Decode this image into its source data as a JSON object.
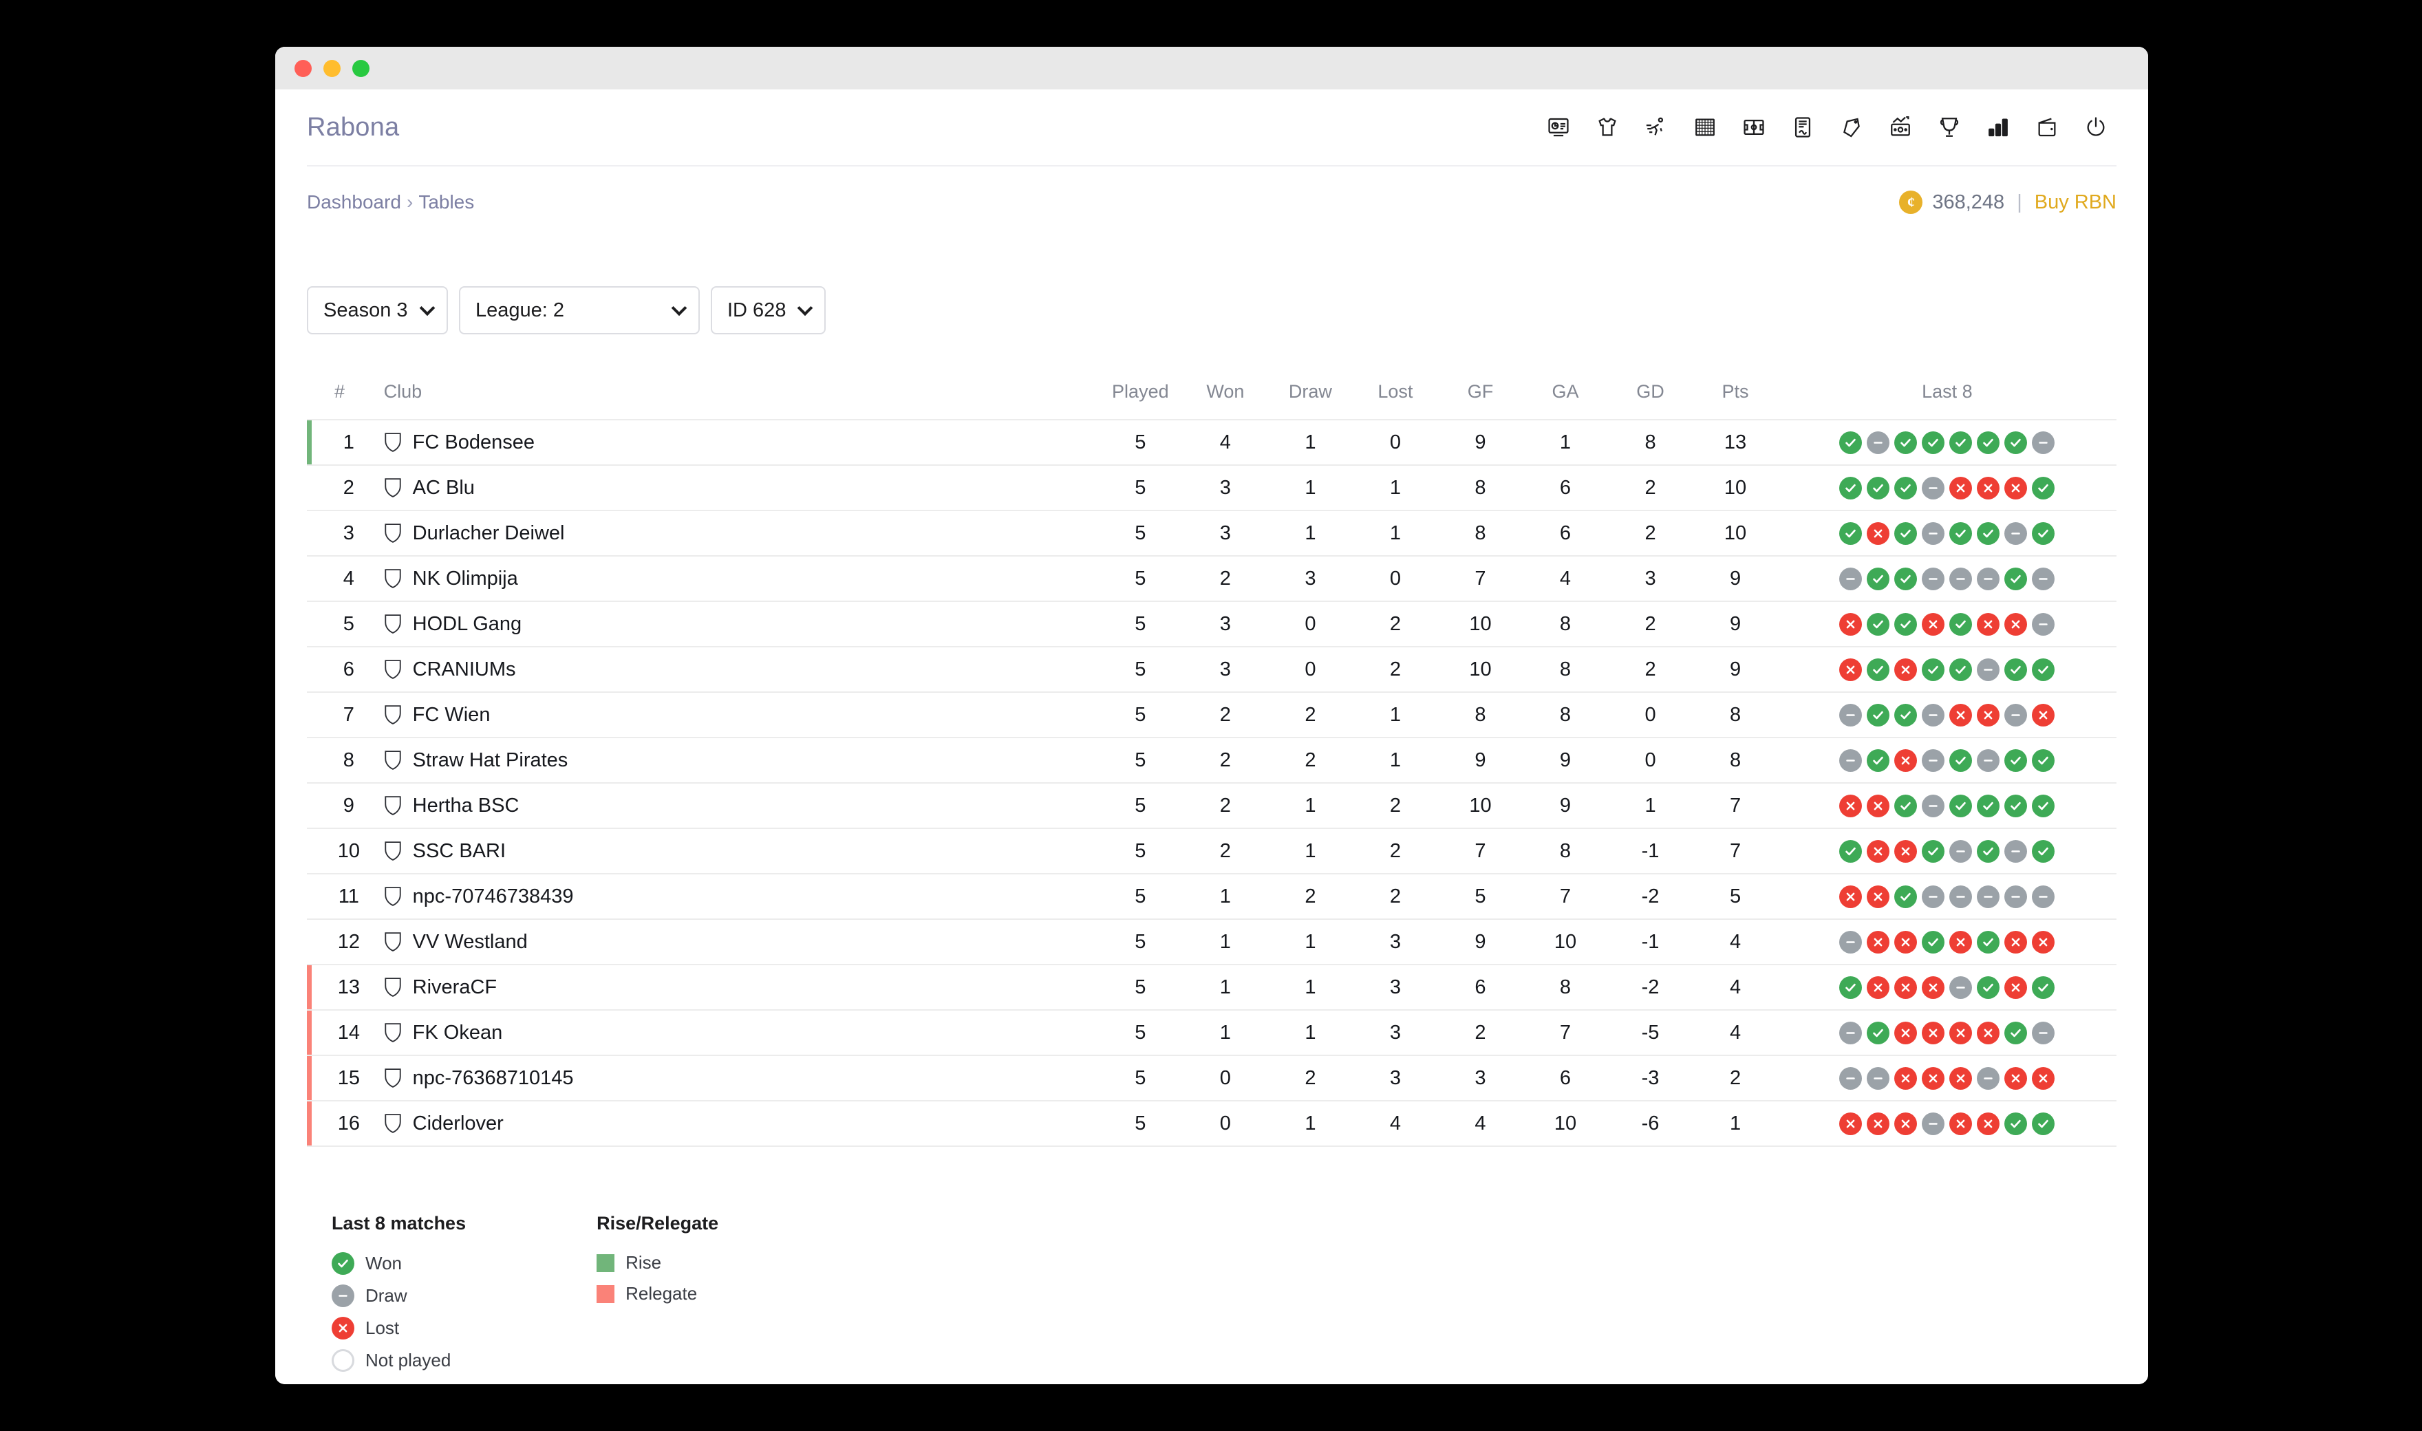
{
  "window": {
    "traffic_lights": [
      "close",
      "minimize",
      "maximize"
    ]
  },
  "header": {
    "brand": "Rabona",
    "icons": [
      "dashboard-icon",
      "jersey-icon",
      "training-icon",
      "goal-net-icon",
      "pitch-icon",
      "contract-icon",
      "tag-icon",
      "transfer-market-icon",
      "trophy-icon",
      "statistics-icon",
      "wallet-icon",
      "power-icon"
    ]
  },
  "breadcrumb": {
    "root": "Dashboard",
    "separator": "›",
    "current": "Tables"
  },
  "balance": {
    "coin_symbol": "¢",
    "amount": "368,248",
    "pipe": "|",
    "buy_label": "Buy RBN",
    "accent_color": "#e0a91e"
  },
  "filters": {
    "season": "Season 3",
    "league": "League: 2",
    "id": "ID 628"
  },
  "table": {
    "headers": {
      "rank": "#",
      "club": "Club",
      "played": "Played",
      "won": "Won",
      "draw": "Draw",
      "lost": "Lost",
      "gf": "GF",
      "ga": "GA",
      "gd": "GD",
      "pts": "Pts",
      "last8": "Last 8"
    },
    "rows": [
      {
        "rank": "1",
        "club": "FC Bodensee",
        "played": "5",
        "won": "4",
        "draw": "1",
        "lost": "0",
        "gf": "9",
        "ga": "1",
        "gd": "8",
        "pts": "13",
        "last8": [
          "W",
          "D",
          "W",
          "W",
          "W",
          "W",
          "W",
          "D"
        ],
        "zone": "rise"
      },
      {
        "rank": "2",
        "club": "AC Blu",
        "played": "5",
        "won": "3",
        "draw": "1",
        "lost": "1",
        "gf": "8",
        "ga": "6",
        "gd": "2",
        "pts": "10",
        "last8": [
          "W",
          "W",
          "W",
          "D",
          "L",
          "L",
          "L",
          "W"
        ],
        "zone": ""
      },
      {
        "rank": "3",
        "club": "Durlacher Deiwel",
        "played": "5",
        "won": "3",
        "draw": "1",
        "lost": "1",
        "gf": "8",
        "ga": "6",
        "gd": "2",
        "pts": "10",
        "last8": [
          "W",
          "L",
          "W",
          "D",
          "W",
          "W",
          "D",
          "W"
        ],
        "zone": ""
      },
      {
        "rank": "4",
        "club": "NK Olimpija",
        "played": "5",
        "won": "2",
        "draw": "3",
        "lost": "0",
        "gf": "7",
        "ga": "4",
        "gd": "3",
        "pts": "9",
        "last8": [
          "D",
          "W",
          "W",
          "D",
          "D",
          "D",
          "W",
          "D"
        ],
        "zone": ""
      },
      {
        "rank": "5",
        "club": "HODL Gang",
        "played": "5",
        "won": "3",
        "draw": "0",
        "lost": "2",
        "gf": "10",
        "ga": "8",
        "gd": "2",
        "pts": "9",
        "last8": [
          "L",
          "W",
          "W",
          "L",
          "W",
          "L",
          "L",
          "D"
        ],
        "zone": ""
      },
      {
        "rank": "6",
        "club": "CRANIUMs",
        "played": "5",
        "won": "3",
        "draw": "0",
        "lost": "2",
        "gf": "10",
        "ga": "8",
        "gd": "2",
        "pts": "9",
        "last8": [
          "L",
          "W",
          "L",
          "W",
          "W",
          "D",
          "W",
          "W"
        ],
        "zone": ""
      },
      {
        "rank": "7",
        "club": "FC Wien",
        "played": "5",
        "won": "2",
        "draw": "2",
        "lost": "1",
        "gf": "8",
        "ga": "8",
        "gd": "0",
        "pts": "8",
        "last8": [
          "D",
          "W",
          "W",
          "D",
          "L",
          "L",
          "D",
          "L"
        ],
        "zone": ""
      },
      {
        "rank": "8",
        "club": "Straw Hat Pirates",
        "played": "5",
        "won": "2",
        "draw": "2",
        "lost": "1",
        "gf": "9",
        "ga": "9",
        "gd": "0",
        "pts": "8",
        "last8": [
          "D",
          "W",
          "L",
          "D",
          "W",
          "D",
          "W",
          "W"
        ],
        "zone": ""
      },
      {
        "rank": "9",
        "club": "Hertha BSC",
        "played": "5",
        "won": "2",
        "draw": "1",
        "lost": "2",
        "gf": "10",
        "ga": "9",
        "gd": "1",
        "pts": "7",
        "last8": [
          "L",
          "L",
          "W",
          "D",
          "W",
          "W",
          "W",
          "W"
        ],
        "zone": ""
      },
      {
        "rank": "10",
        "club": "SSC BARI",
        "played": "5",
        "won": "2",
        "draw": "1",
        "lost": "2",
        "gf": "7",
        "ga": "8",
        "gd": "-1",
        "pts": "7",
        "last8": [
          "W",
          "L",
          "L",
          "W",
          "D",
          "W",
          "D",
          "W"
        ],
        "zone": ""
      },
      {
        "rank": "11",
        "club": "npc-70746738439",
        "played": "5",
        "won": "1",
        "draw": "2",
        "lost": "2",
        "gf": "5",
        "ga": "7",
        "gd": "-2",
        "pts": "5",
        "last8": [
          "L",
          "L",
          "W",
          "D",
          "D",
          "D",
          "D",
          "D"
        ],
        "zone": ""
      },
      {
        "rank": "12",
        "club": "VV Westland",
        "played": "5",
        "won": "1",
        "draw": "1",
        "lost": "3",
        "gf": "9",
        "ga": "10",
        "gd": "-1",
        "pts": "4",
        "last8": [
          "D",
          "L",
          "L",
          "W",
          "L",
          "W",
          "L",
          "L"
        ],
        "zone": ""
      },
      {
        "rank": "13",
        "club": "RiveraCF",
        "played": "5",
        "won": "1",
        "draw": "1",
        "lost": "3",
        "gf": "6",
        "ga": "8",
        "gd": "-2",
        "pts": "4",
        "last8": [
          "W",
          "L",
          "L",
          "L",
          "D",
          "W",
          "L",
          "W"
        ],
        "zone": "relegate"
      },
      {
        "rank": "14",
        "club": "FK Okean",
        "played": "5",
        "won": "1",
        "draw": "1",
        "lost": "3",
        "gf": "2",
        "ga": "7",
        "gd": "-5",
        "pts": "4",
        "last8": [
          "D",
          "W",
          "L",
          "L",
          "L",
          "L",
          "W",
          "D"
        ],
        "zone": "relegate"
      },
      {
        "rank": "15",
        "club": "npc-76368710145",
        "played": "5",
        "won": "0",
        "draw": "2",
        "lost": "3",
        "gf": "3",
        "ga": "6",
        "gd": "-3",
        "pts": "2",
        "last8": [
          "D",
          "D",
          "L",
          "L",
          "L",
          "D",
          "L",
          "L"
        ],
        "zone": "relegate"
      },
      {
        "rank": "16",
        "club": "Ciderlover",
        "played": "5",
        "won": "0",
        "draw": "1",
        "lost": "4",
        "gf": "4",
        "ga": "10",
        "gd": "-6",
        "pts": "1",
        "last8": [
          "L",
          "L",
          "L",
          "D",
          "L",
          "L",
          "W",
          "W"
        ],
        "zone": "relegate"
      }
    ]
  },
  "legend": {
    "matches": {
      "title": "Last 8 matches",
      "items": [
        {
          "state": "W",
          "label": "Won"
        },
        {
          "state": "D",
          "label": "Draw"
        },
        {
          "state": "L",
          "label": "Lost"
        },
        {
          "state": "N",
          "label": "Not played"
        }
      ]
    },
    "zones": {
      "title": "Rise/Relegate",
      "items": [
        {
          "key": "rise",
          "label": "Rise",
          "color": "#71b57a"
        },
        {
          "key": "relegate",
          "label": "Relegate",
          "color": "#fa8278"
        }
      ]
    }
  },
  "colors": {
    "brand": "#7c7fa3",
    "points": "#28a745",
    "win": "#3eaa56",
    "loss": "#ee3e34",
    "draw": "#9ba2a8"
  }
}
